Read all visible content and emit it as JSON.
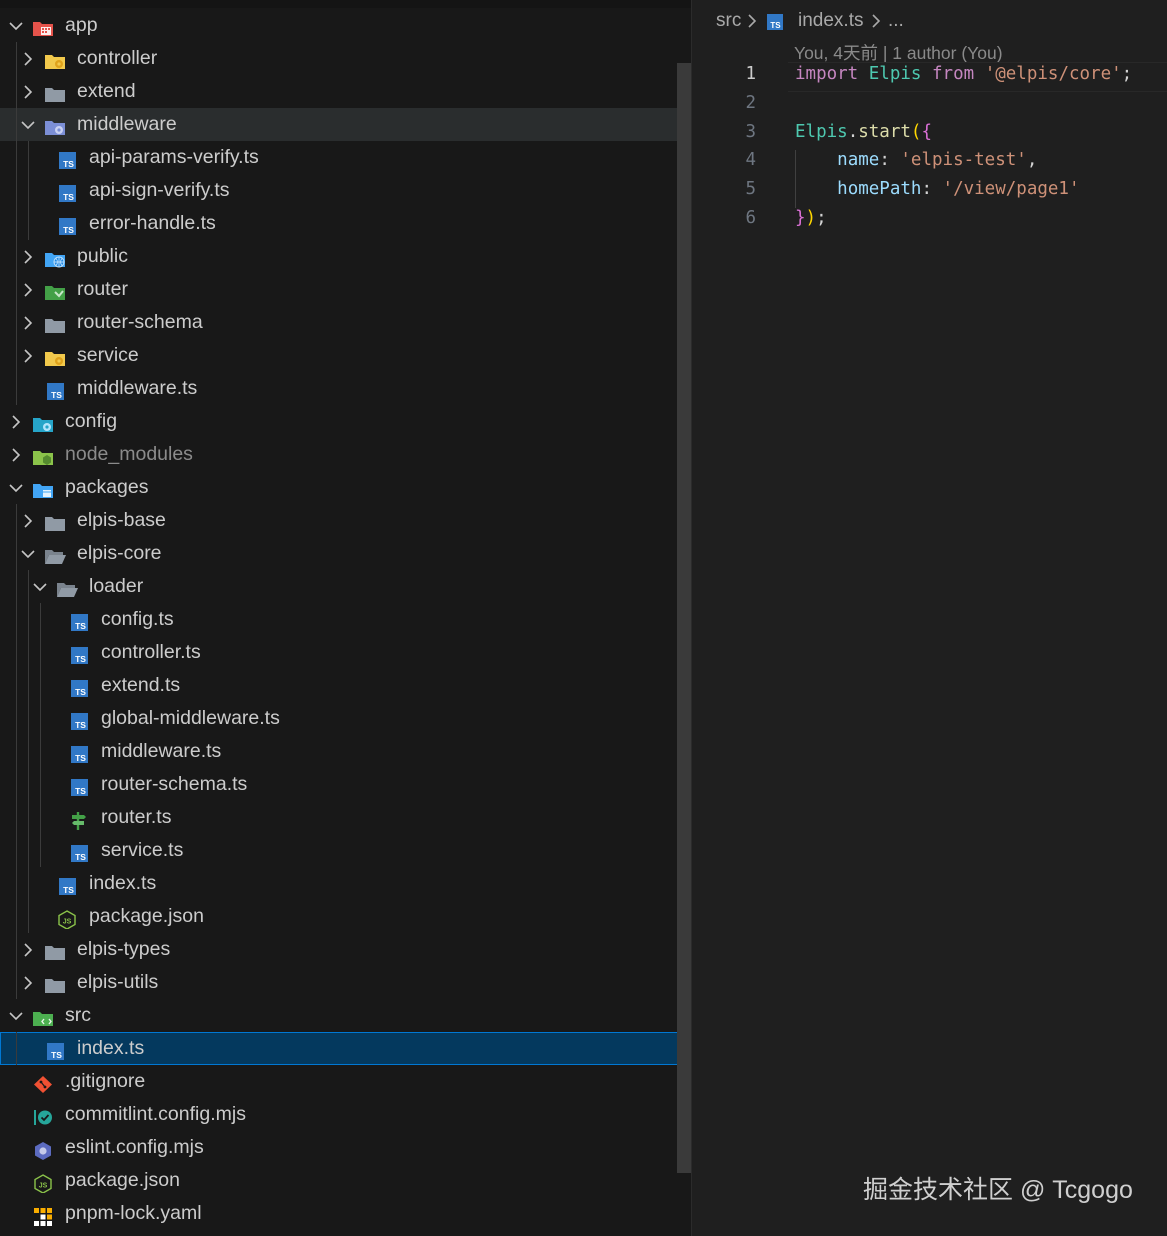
{
  "colors": {
    "folder_gray": "#909aa5",
    "folder_yellow": "#f2c94c",
    "ts_blue": "#3178c6",
    "selection_bg": "#04395e",
    "hover_bg": "#2a2d2e"
  },
  "tree": [
    {
      "id": "app",
      "label": "app",
      "depth": 0,
      "kind": "folder",
      "expanded": true,
      "icon": "app-folder-icon"
    },
    {
      "id": "controller",
      "label": "controller",
      "depth": 1,
      "kind": "folder",
      "expanded": false,
      "icon": "controller-folder-icon"
    },
    {
      "id": "extend",
      "label": "extend",
      "depth": 1,
      "kind": "folder",
      "expanded": false,
      "icon": "folder-icon"
    },
    {
      "id": "middleware",
      "label": "middleware",
      "depth": 1,
      "kind": "folder",
      "expanded": true,
      "icon": "middleware-folder-icon",
      "hover": true
    },
    {
      "id": "api-params-verify",
      "label": "api-params-verify.ts",
      "depth": 2,
      "kind": "file",
      "icon": "typescript-file-icon"
    },
    {
      "id": "api-sign-verify",
      "label": "api-sign-verify.ts",
      "depth": 2,
      "kind": "file",
      "icon": "typescript-file-icon"
    },
    {
      "id": "error-handle",
      "label": "error-handle.ts",
      "depth": 2,
      "kind": "file",
      "icon": "typescript-file-icon"
    },
    {
      "id": "public",
      "label": "public",
      "depth": 1,
      "kind": "folder",
      "expanded": false,
      "icon": "public-folder-icon"
    },
    {
      "id": "router",
      "label": "router",
      "depth": 1,
      "kind": "folder",
      "expanded": false,
      "icon": "router-folder-icon"
    },
    {
      "id": "router-schema",
      "label": "router-schema",
      "depth": 1,
      "kind": "folder",
      "expanded": false,
      "icon": "folder-icon"
    },
    {
      "id": "service",
      "label": "service",
      "depth": 1,
      "kind": "folder",
      "expanded": false,
      "icon": "service-folder-icon"
    },
    {
      "id": "middleware-ts",
      "label": "middleware.ts",
      "depth": 1,
      "kind": "file",
      "icon": "typescript-file-icon"
    },
    {
      "id": "config",
      "label": "config",
      "depth": 0,
      "kind": "folder",
      "expanded": false,
      "icon": "config-folder-icon"
    },
    {
      "id": "node_modules",
      "label": "node_modules",
      "depth": 0,
      "kind": "folder",
      "expanded": false,
      "icon": "node-modules-folder-icon",
      "dim": true
    },
    {
      "id": "packages",
      "label": "packages",
      "depth": 0,
      "kind": "folder",
      "expanded": true,
      "icon": "packages-folder-icon"
    },
    {
      "id": "elpis-base",
      "label": "elpis-base",
      "depth": 1,
      "kind": "folder",
      "expanded": false,
      "icon": "folder-icon"
    },
    {
      "id": "elpis-core",
      "label": "elpis-core",
      "depth": 1,
      "kind": "folder",
      "expanded": true,
      "icon": "folder-open-icon"
    },
    {
      "id": "loader",
      "label": "loader",
      "depth": 2,
      "kind": "folder",
      "expanded": true,
      "icon": "folder-open-icon"
    },
    {
      "id": "loader-config",
      "label": "config.ts",
      "depth": 3,
      "kind": "file",
      "icon": "typescript-file-icon"
    },
    {
      "id": "loader-controller",
      "label": "controller.ts",
      "depth": 3,
      "kind": "file",
      "icon": "typescript-file-icon"
    },
    {
      "id": "loader-extend",
      "label": "extend.ts",
      "depth": 3,
      "kind": "file",
      "icon": "typescript-file-icon"
    },
    {
      "id": "loader-global-middleware",
      "label": "global-middleware.ts",
      "depth": 3,
      "kind": "file",
      "icon": "typescript-file-icon"
    },
    {
      "id": "loader-middleware",
      "label": "middleware.ts",
      "depth": 3,
      "kind": "file",
      "icon": "typescript-file-icon"
    },
    {
      "id": "loader-router-schema",
      "label": "router-schema.ts",
      "depth": 3,
      "kind": "file",
      "icon": "typescript-file-icon"
    },
    {
      "id": "loader-router",
      "label": "router.ts",
      "depth": 3,
      "kind": "file",
      "icon": "router-file-icon"
    },
    {
      "id": "loader-service",
      "label": "service.ts",
      "depth": 3,
      "kind": "file",
      "icon": "typescript-file-icon"
    },
    {
      "id": "core-index",
      "label": "index.ts",
      "depth": 2,
      "kind": "file",
      "icon": "typescript-file-icon"
    },
    {
      "id": "core-package-json",
      "label": "package.json",
      "depth": 2,
      "kind": "file",
      "icon": "nodejs-file-icon"
    },
    {
      "id": "elpis-types",
      "label": "elpis-types",
      "depth": 1,
      "kind": "folder",
      "expanded": false,
      "icon": "folder-icon"
    },
    {
      "id": "elpis-utils",
      "label": "elpis-utils",
      "depth": 1,
      "kind": "folder",
      "expanded": false,
      "icon": "folder-icon"
    },
    {
      "id": "src",
      "label": "src",
      "depth": 0,
      "kind": "folder",
      "expanded": true,
      "icon": "src-folder-icon"
    },
    {
      "id": "src-index",
      "label": "index.ts",
      "depth": 1,
      "kind": "file",
      "icon": "typescript-file-icon",
      "selected": true
    },
    {
      "id": "gitignore",
      "label": ".gitignore",
      "depth": 0,
      "kind": "file",
      "icon": "git-file-icon"
    },
    {
      "id": "commitlint",
      "label": "commitlint.config.mjs",
      "depth": 0,
      "kind": "file",
      "icon": "commitlint-file-icon"
    },
    {
      "id": "eslint",
      "label": "eslint.config.mjs",
      "depth": 0,
      "kind": "file",
      "icon": "eslint-file-icon"
    },
    {
      "id": "root-package-json",
      "label": "package.json",
      "depth": 0,
      "kind": "file",
      "icon": "nodejs-file-icon"
    },
    {
      "id": "pnpm-lock",
      "label": "pnpm-lock.yaml",
      "depth": 0,
      "kind": "file",
      "icon": "pnpm-file-icon"
    }
  ],
  "editor": {
    "breadcrumb": {
      "folder": "src",
      "file": "index.ts",
      "ellipsis": "..."
    },
    "blame": "You, 4天前 | 1 author (You)",
    "line_numbers": [
      "1",
      "2",
      "3",
      "4",
      "5",
      "6"
    ],
    "active_line": 1,
    "lines": [
      [
        {
          "t": "import",
          "c": "kw"
        },
        {
          "t": " ",
          "c": "pn"
        },
        {
          "t": "Elpis",
          "c": "cls"
        },
        {
          "t": " ",
          "c": "pn"
        },
        {
          "t": "from",
          "c": "kw"
        },
        {
          "t": " ",
          "c": "pn"
        },
        {
          "t": "'@elpis/core'",
          "c": "str"
        },
        {
          "t": ";",
          "c": "pn"
        }
      ],
      [],
      [
        {
          "t": "Elpis",
          "c": "cls"
        },
        {
          "t": ".",
          "c": "pn"
        },
        {
          "t": "start",
          "c": "fn"
        },
        {
          "t": "(",
          "c": "br1"
        },
        {
          "t": "{",
          "c": "br2"
        }
      ],
      [
        {
          "t": "    ",
          "c": "pn"
        },
        {
          "t": "name",
          "c": "var"
        },
        {
          "t": ": ",
          "c": "pn"
        },
        {
          "t": "'elpis-test'",
          "c": "str"
        },
        {
          "t": ",",
          "c": "pn"
        }
      ],
      [
        {
          "t": "    ",
          "c": "pn"
        },
        {
          "t": "homePath",
          "c": "var"
        },
        {
          "t": ": ",
          "c": "pn"
        },
        {
          "t": "'/view/page1'",
          "c": "str"
        }
      ],
      [
        {
          "t": "}",
          "c": "br2"
        },
        {
          "t": ")",
          "c": "br1"
        },
        {
          "t": ";",
          "c": "pn"
        }
      ]
    ]
  },
  "watermark": "掘金技术社区 @ Tcgogo"
}
